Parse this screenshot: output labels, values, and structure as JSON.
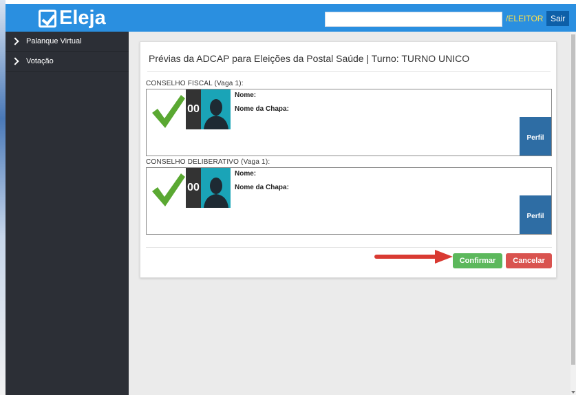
{
  "header": {
    "logo_text": "Eleja",
    "search_value": "",
    "user_link": "/ELEITOR",
    "logout_label": "Sair"
  },
  "sidebar": {
    "items": [
      {
        "label": "Palanque Virtual"
      },
      {
        "label": "Votação"
      }
    ]
  },
  "ballot": {
    "title": "Prévias da ADCAP para Eleições da Postal Saúde | Turno: TURNO UNICO",
    "sections": [
      {
        "label": "CONSELHO FISCAL (Vaga 1):",
        "number": "00",
        "name_label": "Nome:",
        "slate_label": "Nome da Chapa:",
        "profile_label": "Perfil"
      },
      {
        "label": "CONSELHO DELIBERATIVO (Vaga 1):",
        "number": "00",
        "name_label": "Nome:",
        "slate_label": "Nome da Chapa:",
        "profile_label": "Perfil"
      }
    ],
    "confirm_label": "Confirmar",
    "cancel_label": "Cancelar"
  },
  "icons": {
    "logo": "checkbox-icon",
    "check": "green-checkmark-icon",
    "avatar": "person-silhouette-icon",
    "chevron": "chevron-right-icon",
    "annotation": "red-arrow-icon"
  },
  "colors": {
    "topbar": "#2a8fe0",
    "sidebar": "#2c2f36",
    "user_link": "#ffe04a",
    "profile_button": "#2e6da4",
    "confirm": "#5cb85c",
    "cancel": "#d9534f",
    "check": "#5aa832",
    "photo": "#1aa4b7",
    "annotation": "#d93a32"
  }
}
